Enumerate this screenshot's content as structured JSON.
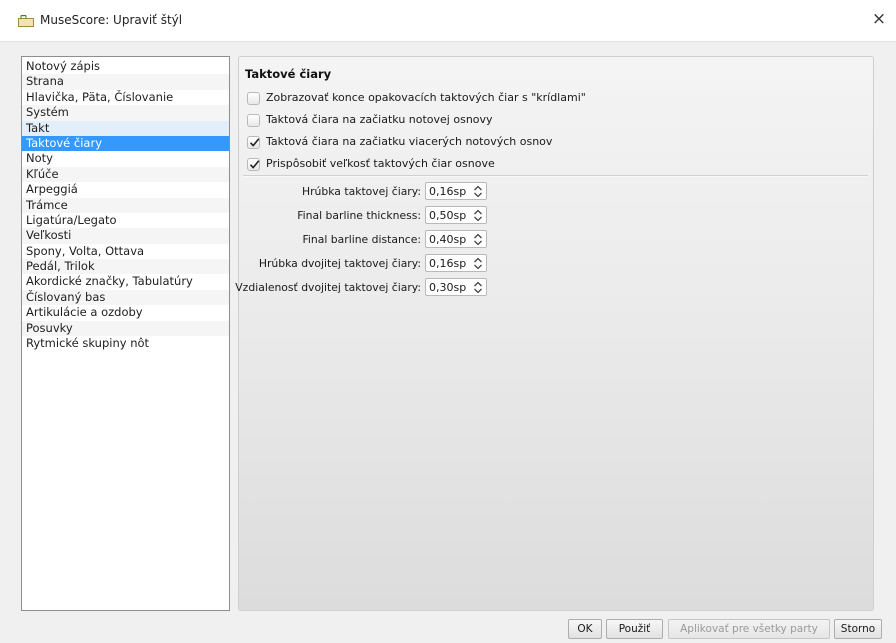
{
  "window": {
    "title": "MuseScore: Upraviť štýl",
    "icon": "musescore-app-icon",
    "close_label": "×"
  },
  "sidebar": {
    "items": [
      {
        "label": "Notový zápis",
        "state": "normal"
      },
      {
        "label": "Strana",
        "state": "normal"
      },
      {
        "label": "Hlavička, Päta, Číslovanie",
        "state": "normal"
      },
      {
        "label": "Systém",
        "state": "normal"
      },
      {
        "label": "Takt",
        "state": "hover"
      },
      {
        "label": "Taktové čiary",
        "state": "selected"
      },
      {
        "label": "Noty",
        "state": "normal"
      },
      {
        "label": "Kľúče",
        "state": "normal"
      },
      {
        "label": "Arpeggiá",
        "state": "normal"
      },
      {
        "label": "Trámce",
        "state": "normal"
      },
      {
        "label": "Ligatúra/Legato",
        "state": "normal"
      },
      {
        "label": "Veľkosti",
        "state": "normal"
      },
      {
        "label": "Spony, Volta, Ottava",
        "state": "normal"
      },
      {
        "label": "Pedál, Trilok",
        "state": "normal"
      },
      {
        "label": "Akordické značky, Tabulatúry",
        "state": "normal"
      },
      {
        "label": "Číslovaný bas",
        "state": "normal"
      },
      {
        "label": "Artikulácie a ozdoby",
        "state": "normal"
      },
      {
        "label": "Posuvky",
        "state": "normal"
      },
      {
        "label": "Rytmické skupiny nôt",
        "state": "normal"
      }
    ]
  },
  "panel": {
    "title": "Taktové čiary",
    "checkboxes": [
      {
        "label": "Zobrazovať konce opakovacích taktových čiar s \"krídlami\"",
        "checked": false
      },
      {
        "label": "Taktová čiara na začiatku notovej osnovy",
        "checked": false
      },
      {
        "label": "Taktová čiara na začiatku viacerých notových osnov",
        "checked": true
      },
      {
        "label": "Prispôsobiť veľkosť taktových čiar osnove",
        "checked": true
      }
    ],
    "properties": [
      {
        "label": "Hrúbka taktovej čiary:",
        "value": "0,16sp"
      },
      {
        "label": "Final barline thickness:",
        "value": "0,50sp"
      },
      {
        "label": "Final barline distance:",
        "value": "0,40sp"
      },
      {
        "label": "Hrúbka dvojitej taktovej čiary:",
        "value": "0,16sp"
      },
      {
        "label": "Vzdialenosť dvojitej taktovej čiary:",
        "value": "0,30sp"
      }
    ]
  },
  "footer": {
    "ok_label": "OK",
    "apply_label": "Použiť",
    "apply_all_label": "Aplikovať pre všetky party",
    "cancel_label": "Storno"
  },
  "colors": {
    "selection": "#3399ff",
    "hover": "#e3eefb"
  }
}
